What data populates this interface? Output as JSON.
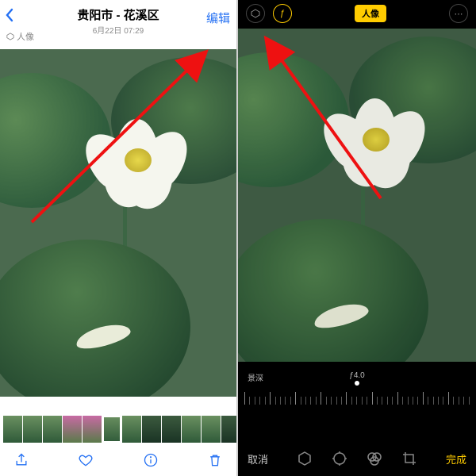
{
  "left": {
    "location": "贵阳市 - 花溪区",
    "timestamp": "6月22日 07:29",
    "back_icon": "chevron-left-icon",
    "edit_label": "编辑",
    "mode_badge": "人像",
    "toolbar": {
      "share_icon": "share-icon",
      "like_icon": "heart-icon",
      "info_icon": "info-icon",
      "delete_icon": "trash-icon"
    },
    "thumbnails_count": 12
  },
  "right": {
    "top": {
      "hex_icon": "hexagon-icon",
      "flash_icon": "flash-icon",
      "mode_badge": "人像",
      "more_icon": "more-icon"
    },
    "depth_label": "景深",
    "aperture_value": "ƒ4.0",
    "cancel_label": "取消",
    "done_label": "完成",
    "edit_icons": {
      "cube": "cube-icon",
      "adjust": "adjust-icon",
      "filters": "filters-icon",
      "crop": "crop-icon"
    }
  },
  "colors": {
    "ios_blue": "#2470f3",
    "ios_yellow": "#ffcc00",
    "arrow_red": "#e11"
  }
}
